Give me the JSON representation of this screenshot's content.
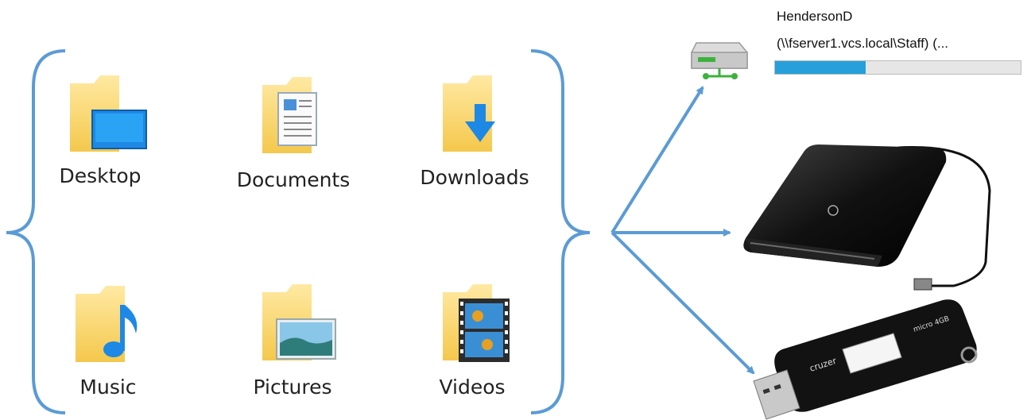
{
  "folders": [
    {
      "label": "Desktop",
      "icon": "desktop-folder-icon"
    },
    {
      "label": "Documents",
      "icon": "documents-folder-icon"
    },
    {
      "label": "Downloads",
      "icon": "downloads-folder-icon"
    },
    {
      "label": "Music",
      "icon": "music-folder-icon"
    },
    {
      "label": "Pictures",
      "icon": "pictures-folder-icon"
    },
    {
      "label": "Videos",
      "icon": "videos-folder-icon"
    }
  ],
  "network_drive": {
    "name": "HendersonD",
    "path": "(\\\\fserver1.vcs.local\\Staff) (...",
    "usage_fraction": 0.37,
    "icon": "network-drive-icon"
  },
  "devices": [
    {
      "icon": "external-hard-drive-icon"
    },
    {
      "icon": "usb-flash-drive-icon",
      "brand_text": "cruzer",
      "capacity_text": "micro 4GB"
    }
  ],
  "colors": {
    "arrow": "#5b9bd5",
    "brace": "#5b9bd5",
    "folder_yellow": "#f8d775",
    "progress": "#26a0da"
  }
}
